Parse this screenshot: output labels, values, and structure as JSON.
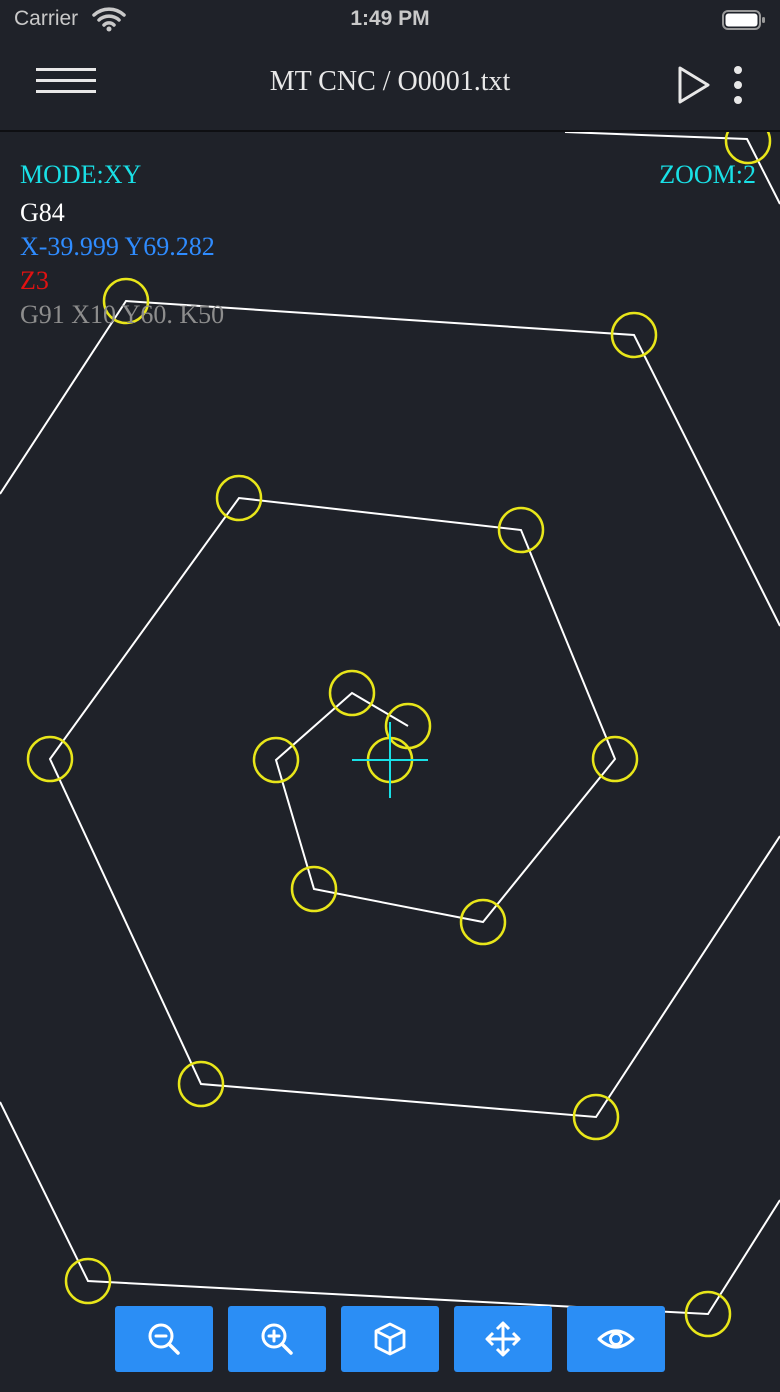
{
  "status_bar": {
    "carrier": "Carrier",
    "time": "1:49 PM",
    "icons": [
      "wifi-icon",
      "battery-icon"
    ]
  },
  "header": {
    "title": "MT CNC / O0001.txt",
    "menu_icon": "hamburger-menu-icon",
    "play_icon": "play-icon",
    "more_icon": "more-vertical-icon"
  },
  "overlay": {
    "mode": "MODE:XY",
    "zoom": "ZOOM:2",
    "gcode": "G84",
    "coords": "X-39.999 Y69.282",
    "z": "Z3",
    "next_line": "G91 X10 Y60. K50"
  },
  "colors": {
    "background": "#1f2229",
    "path": "#ffffff",
    "drill_circle": "#e8e61a",
    "crosshair": "#19e0e6",
    "mode_text": "#19e0e6",
    "coords_text": "#2f8cff",
    "z_text": "#e01212",
    "next_text": "#8d8d8d",
    "toolbar_button": "#2b8ef5"
  },
  "toolbar": {
    "buttons": [
      {
        "name": "zoom-out-button",
        "icon": "zoom-out-icon"
      },
      {
        "name": "zoom-in-button",
        "icon": "zoom-in-icon"
      },
      {
        "name": "3d-view-button",
        "icon": "cube-icon"
      },
      {
        "name": "pan-button",
        "icon": "move-arrows-icon"
      },
      {
        "name": "view-button",
        "icon": "eye-icon"
      }
    ]
  }
}
